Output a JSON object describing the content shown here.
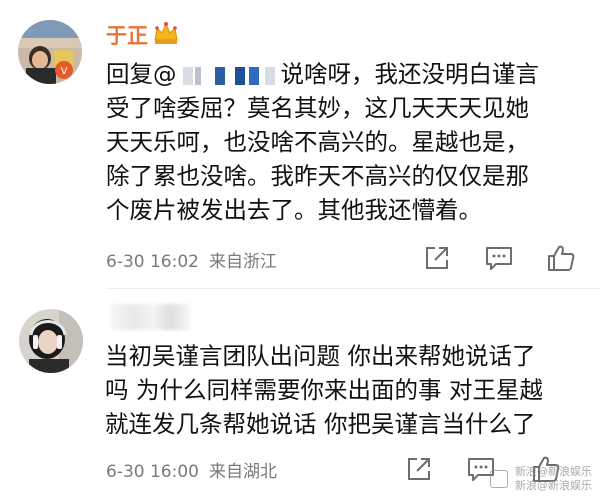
{
  "comments": [
    {
      "username": "于正",
      "reply_prefix": "回复@",
      "body_line1_tail": "说啥呀，我还没明白谨言",
      "body_lines": [
        "受了啥委屈？莫名其妙，这几天天天见她",
        "天天乐呵，也没啥不高兴的。星越也是，",
        "除了累也没啥。我昨天不高兴的仅仅是那",
        "个废片被发出去了。其他我还懵着。"
      ],
      "time": "6-30 16:02",
      "location": "来自浙江"
    },
    {
      "body_lines": [
        "当初吴谨言团队出问题 你出来帮她说话了",
        "吗 为什么同样需要你来出面的事 对王星越",
        "就连发几条帮她说话 你把吴谨言当什么了"
      ],
      "time": "6-30 16:00",
      "location": "来自湖北"
    }
  ],
  "watermark": {
    "line1": "新浪@新浪娱乐",
    "line2": "新浪@新浪娱乐"
  },
  "colors": {
    "username_orange": "#e8743a",
    "mention_blue": "#1e6fd0",
    "meta_gray": "#7a7a7a"
  },
  "icons": [
    "share-icon",
    "comment-icon",
    "like-icon",
    "crown-badge-icon"
  ]
}
